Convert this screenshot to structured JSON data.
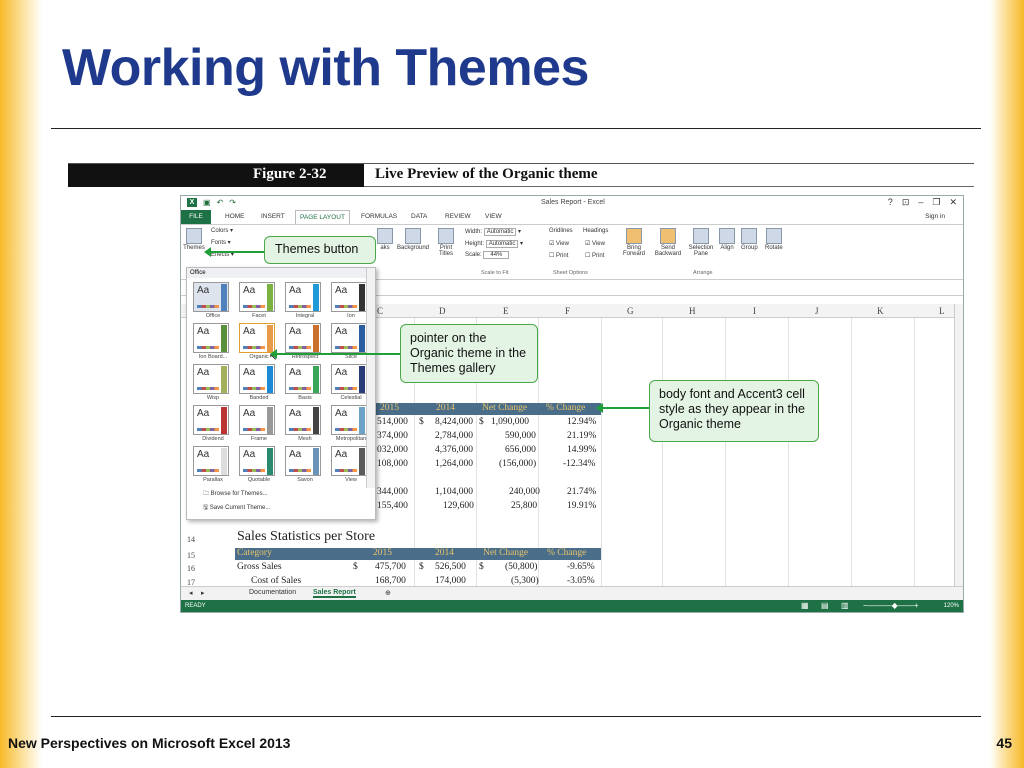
{
  "slide": {
    "title": "Working with Themes",
    "footer": "New Perspectives on Microsoft Excel 2013",
    "page_number": "45"
  },
  "figure": {
    "number": "Figure 2-32",
    "caption": "Live Preview of the Organic theme"
  },
  "excel": {
    "window_title": "Sales Report - Excel",
    "tabs": [
      "FILE",
      "HOME",
      "INSERT",
      "PAGE LAYOUT",
      "FORMULAS",
      "DATA",
      "REVIEW",
      "VIEW"
    ],
    "active_tab": "PAGE LAYOUT",
    "sign_in": "Sign in",
    "ribbon": {
      "themes": "Themes",
      "colors": "Colors",
      "fonts": "Fonts",
      "effects": "Effects",
      "breaks": "aks",
      "background": "Background",
      "print_titles": "Print Titles",
      "width_label": "Width:",
      "width_value": "Automatic",
      "height_label": "Height:",
      "height_value": "Automatic",
      "scale_label": "Scale:",
      "scale_value": "44%",
      "scale_group": "Scale to Fit",
      "gridlines": "Gridlines",
      "headings": "Headings",
      "view": "View",
      "print": "Print",
      "sheet_options": "Sheet Options",
      "bring_forward": "Bring Forward",
      "send_backward": "Send Backward",
      "selection_pane": "Selection Pane",
      "align": "Align",
      "group": "Group",
      "rotate": "Rotate",
      "arrange": "Arrange"
    },
    "columns": [
      "C",
      "D",
      "E",
      "F",
      "G",
      "H",
      "I",
      "J",
      "K",
      "L"
    ],
    "table1": {
      "headers": [
        "2015",
        "2014",
        "Net Change",
        "% Change"
      ],
      "rows": [
        [
          "514,000",
          "$",
          "8,424,000",
          "$",
          "1,090,000",
          "12.94%"
        ],
        [
          "374,000",
          "",
          "2,784,000",
          "",
          "590,000",
          "21.19%"
        ],
        [
          "032,000",
          "",
          "4,376,000",
          "",
          "656,000",
          "14.99%"
        ],
        [
          "108,000",
          "",
          "1,264,000",
          "",
          "(156,000)",
          "-12.34%"
        ]
      ],
      "rows2": [
        [
          "344,000",
          "1,104,000",
          "240,000",
          "21.74%"
        ],
        [
          "155,400",
          "129,600",
          "25,800",
          "19.91%"
        ]
      ]
    },
    "section_title": "Sales Statistics per Store",
    "table2": {
      "headers": [
        "Category",
        "2015",
        "2014",
        "Net Change",
        "% Change"
      ],
      "rows": [
        {
          "row": "16",
          "label": "Gross Sales",
          "c": "$",
          "v2015": "475,700",
          "d": "$",
          "v2014": "526,500",
          "e": "$",
          "net": "(50,800)",
          "pct": "-9.65%"
        },
        {
          "row": "17",
          "label": "Cost of Sales",
          "c": "",
          "v2015": "168,700",
          "d": "",
          "v2014": "174,000",
          "e": "",
          "net": "(5,300)",
          "pct": "-3.05%"
        }
      ],
      "row_numbers": [
        "14",
        "15"
      ]
    },
    "sheets": [
      "Documentation",
      "Sales Report"
    ],
    "active_sheet": "Sales Report",
    "status": "READY",
    "zoom": "120%"
  },
  "gallery": {
    "section": "Office",
    "themes": [
      {
        "name": "Office",
        "aa": "Aa",
        "strip": "#4f81bd"
      },
      {
        "name": "Facet",
        "aa": "Aa",
        "strip": "#7cb340"
      },
      {
        "name": "Integral",
        "aa": "Aa",
        "strip": "#1e9bd7"
      },
      {
        "name": "Ion",
        "aa": "Aa",
        "strip": "#333"
      },
      {
        "name": "Ion Board...",
        "aa": "Aa",
        "strip": "#5a8f3c"
      },
      {
        "name": "Organic",
        "aa": "Aa",
        "strip": "#e69a4a"
      },
      {
        "name": "Retrospect",
        "aa": "Aa",
        "strip": "#c8702c"
      },
      {
        "name": "Slice",
        "aa": "Aa",
        "strip": "#2b5e9e"
      },
      {
        "name": "Wisp",
        "aa": "Aa",
        "strip": "#a5b05c"
      },
      {
        "name": "Banded",
        "aa": "Aa",
        "strip": "#1e8ad6"
      },
      {
        "name": "Basis",
        "aa": "Aa",
        "strip": "#3aa65a"
      },
      {
        "name": "Celestial",
        "aa": "Aa",
        "strip": "#2a3b7a"
      },
      {
        "name": "Dividend",
        "aa": "Aa",
        "strip": "#b33"
      },
      {
        "name": "Frame",
        "aa": "Aa",
        "strip": "#999"
      },
      {
        "name": "Mesh",
        "aa": "Aa",
        "strip": "#444"
      },
      {
        "name": "Metropolitan",
        "aa": "Aa",
        "strip": "#6ea2c9"
      },
      {
        "name": "Parallax",
        "aa": "Aa",
        "strip": "#ddd"
      },
      {
        "name": "Quotable",
        "aa": "Aa",
        "strip": "#2a8a70"
      },
      {
        "name": "Savon",
        "aa": "Aa",
        "strip": "#6b93b8"
      },
      {
        "name": "View",
        "aa": "Aa",
        "strip": "#5c5c5c"
      }
    ],
    "browse": "Browse for Themes...",
    "save": "Save Current Theme..."
  },
  "callouts": {
    "themes_button": "Themes button",
    "pointer": "pointer on the Organic theme in the Themes gallery",
    "body_font": "body font and Accent3 cell style as they appear in the Organic theme"
  },
  "colors": {
    "title": "#1f3a8c",
    "excel_green": "#1e7145",
    "callout_fill": "#e4f4e4",
    "callout_border": "#4aa84a",
    "accent_header": "#4a6e8a"
  }
}
